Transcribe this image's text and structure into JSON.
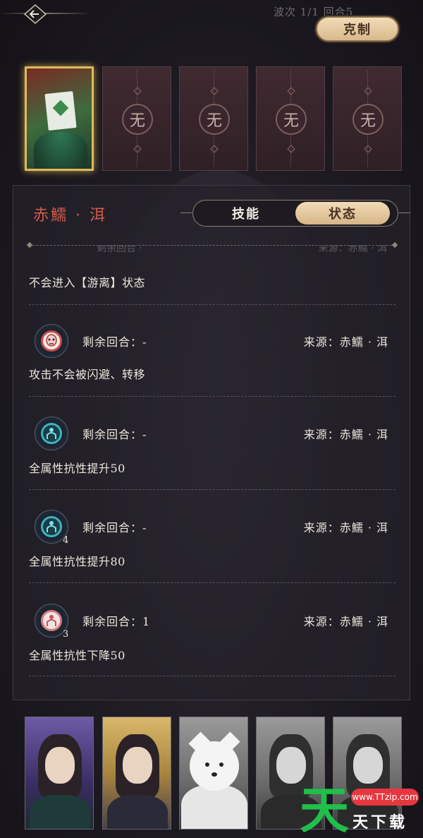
{
  "header": {
    "wave_info": "波次 1/1 回合5",
    "counter_label": "克制",
    "back_icon": "back-arrow-icon"
  },
  "top_cards": [
    {
      "type": "portrait",
      "selected": true
    },
    {
      "type": "empty",
      "label": "无"
    },
    {
      "type": "empty",
      "label": "无"
    },
    {
      "type": "empty",
      "label": "无"
    },
    {
      "type": "empty",
      "label": "无"
    }
  ],
  "panel": {
    "character_name": "赤鱬 · 洱",
    "tabs": [
      {
        "label": "技能",
        "active": false
      },
      {
        "label": "状态",
        "active": true
      }
    ],
    "ghost_row": {
      "rounds": "剩余回合 ·",
      "source": "来源：赤鱬 · 洱"
    },
    "first_desc": "不会进入【游离】状态",
    "statuses": [
      {
        "icon": "mask-icon",
        "stack": "",
        "rounds": "剩余回合：-",
        "source": "来源：赤鱬 · 洱",
        "desc": "攻击不会被闪避、转移"
      },
      {
        "icon": "shield-buff-icon",
        "stack": "",
        "rounds": "剩余回合：-",
        "source": "来源：赤鱬 · 洱",
        "desc": "全属性抗性提升50"
      },
      {
        "icon": "shield-buff-icon",
        "stack": "4",
        "rounds": "剩余回合：-",
        "source": "来源：赤鱬 · 洱",
        "desc": "全属性抗性提升80"
      },
      {
        "icon": "resist-debuff-icon",
        "stack": "3",
        "rounds": "剩余回合：1",
        "source": "来源：赤鱬 · 洱",
        "desc": "全属性抗性下降50"
      }
    ]
  },
  "roster": [
    {
      "frame": "purple"
    },
    {
      "frame": "gold"
    },
    {
      "frame": "gray",
      "kind": "dog"
    },
    {
      "frame": "gray"
    },
    {
      "frame": "gray"
    }
  ],
  "watermark": {
    "logo": "天",
    "url": "www.TTzip.com",
    "text": "天下载"
  },
  "colors": {
    "accent_gold": "#e0b95a",
    "name_red": "#d25b4c",
    "tab_active_bg": "#e8cba0"
  }
}
